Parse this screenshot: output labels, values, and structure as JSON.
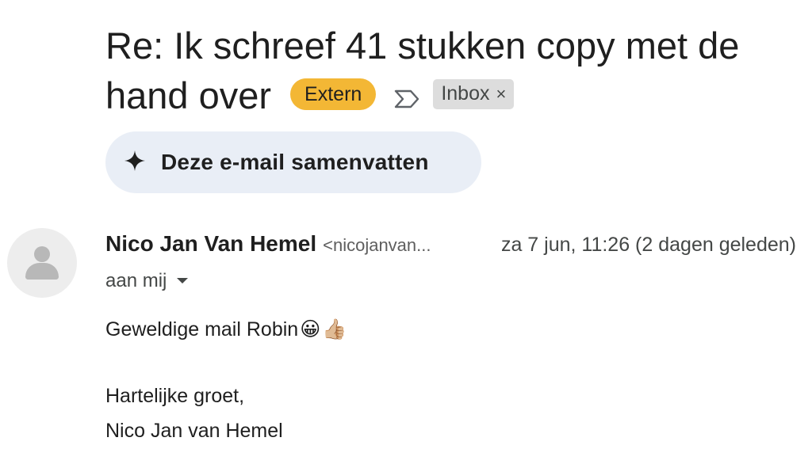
{
  "subject": {
    "line1": "Re: Ik schreef 41 stukken copy met de",
    "line2": "hand over"
  },
  "labels": {
    "extern": "Extern",
    "inbox": "Inbox",
    "inbox_remove": "×"
  },
  "icons": {
    "importance": "importance-marker-icon",
    "sparkle": "sparkle-icon",
    "avatar": "default-avatar-icon",
    "caret": "caret-down-icon",
    "emoji_grin": "😀",
    "emoji_thumbs": "👍🏼"
  },
  "colors": {
    "extern_badge": "#f3b735",
    "inbox_label": "#dddddd",
    "summarize_bg": "#e9eef6"
  },
  "summarize_button": "Deze e-mail samenvatten",
  "message": {
    "sender_name": "Nico Jan Van Hemel",
    "sender_email": "<nicojanvan...",
    "date": "za 7 jun, 11:26 (2 dagen geleden)",
    "recipient": "aan mij",
    "body_line1": "Geweldige mail Robin",
    "closing1": "Hartelijke groet,",
    "closing2": "Nico Jan van Hemel"
  }
}
